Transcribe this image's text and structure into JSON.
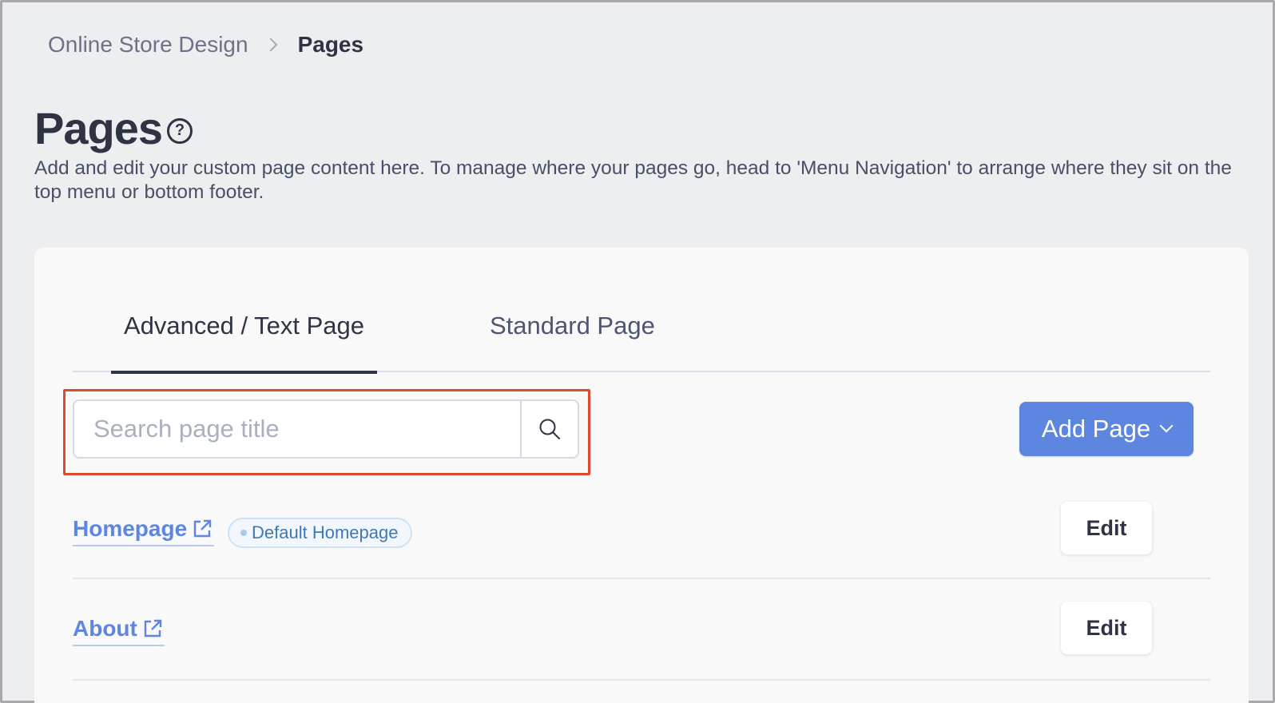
{
  "breadcrumb": {
    "parent": "Online Store Design",
    "current": "Pages"
  },
  "header": {
    "title": "Pages",
    "help_icon": "question-circle-icon",
    "description": "Add and edit your custom page content here. To manage where your pages go, head to 'Menu Navigation' to arrange where they sit on the top menu or bottom footer."
  },
  "tabs": [
    {
      "label": "Advanced / Text Page",
      "active": true
    },
    {
      "label": "Standard Page",
      "active": false
    }
  ],
  "search": {
    "placeholder": "Search page title",
    "value": "",
    "icon": "search-icon"
  },
  "add_page": {
    "label": "Add Page",
    "icon": "chevron-down-icon"
  },
  "pages": [
    {
      "title": "Homepage",
      "badge": "Default Homepage",
      "edit_label": "Edit"
    },
    {
      "title": "About",
      "edit_label": "Edit"
    }
  ],
  "colors": {
    "accent": "#5d86e1",
    "highlight": "#e04a2c",
    "background": "#edeef0"
  }
}
